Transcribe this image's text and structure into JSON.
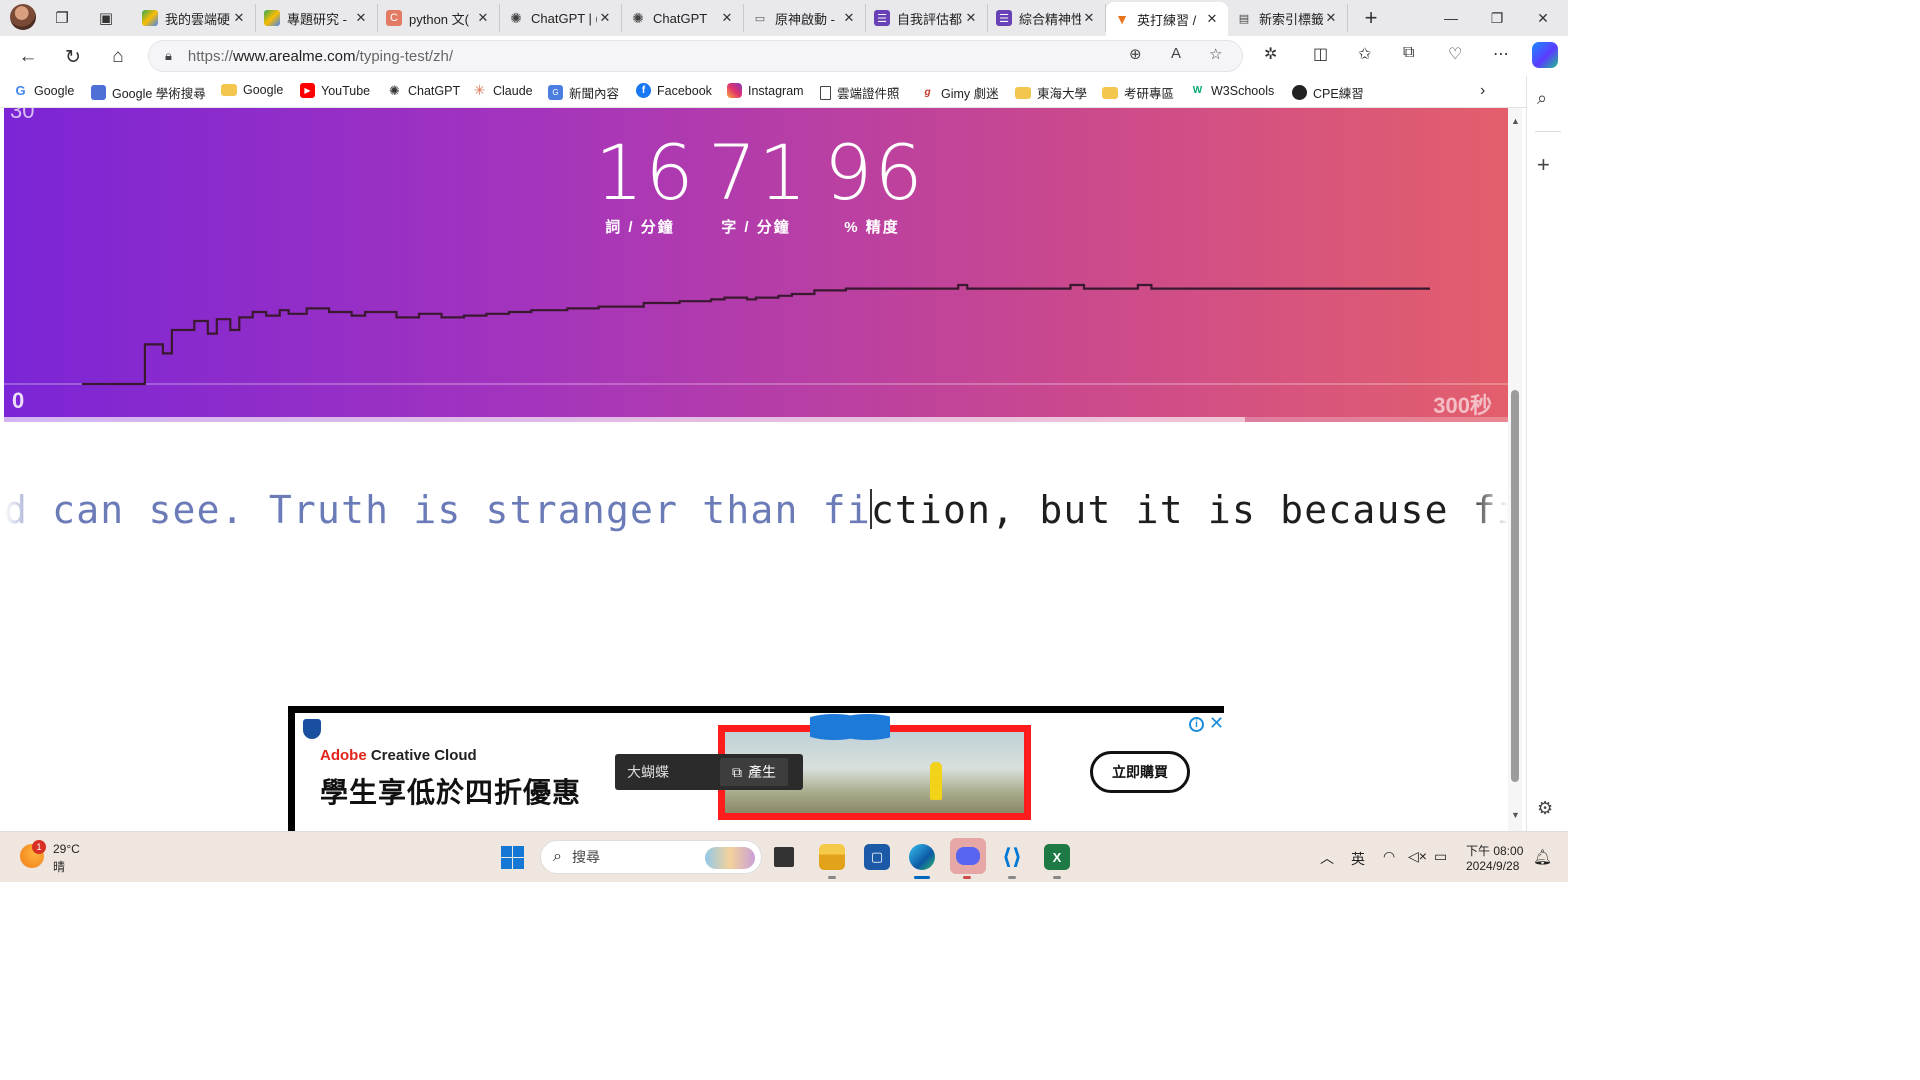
{
  "browser": {
    "tabs": [
      {
        "label": "我的雲端硬",
        "icon": "google-drive-icon",
        "active": false
      },
      {
        "label": "專題研究 -",
        "icon": "google-drive-icon",
        "active": false
      },
      {
        "label": "python 文(",
        "icon": "c-letter-icon",
        "active": false
      },
      {
        "label": "ChatGPT | (",
        "icon": "chatgpt-icon",
        "active": false
      },
      {
        "label": "ChatGPT",
        "icon": "chatgpt-icon",
        "active": false
      },
      {
        "label": "原神啟動 -",
        "icon": "chat-bubble-icon",
        "active": false
      },
      {
        "label": "自我評估都",
        "icon": "form-icon",
        "active": false
      },
      {
        "label": "綜合精神性",
        "icon": "form-icon",
        "active": false
      },
      {
        "label": "英打練習 /",
        "icon": "fox-icon",
        "active": true
      },
      {
        "label": "新索引標籤",
        "icon": "newtab-icon",
        "active": false
      }
    ],
    "url_prefix": "https://",
    "url_host": "www.arealme.com",
    "url_path": "/typing-test/zh/",
    "favorites": [
      {
        "label": "Google",
        "icon": "google-icon"
      },
      {
        "label": "Google 學術搜尋",
        "icon": "scholar-icon"
      },
      {
        "label": "Google",
        "icon": "folder-icon"
      },
      {
        "label": "YouTube",
        "icon": "youtube-icon"
      },
      {
        "label": "ChatGPT",
        "icon": "chatgpt-icon"
      },
      {
        "label": "Claude",
        "icon": "claude-icon"
      },
      {
        "label": "新聞內容",
        "icon": "news-icon"
      },
      {
        "label": "Facebook",
        "icon": "facebook-icon"
      },
      {
        "label": "Instagram",
        "icon": "instagram-icon"
      },
      {
        "label": "雲端證件照",
        "icon": "page-icon"
      },
      {
        "label": "Gimy 劇迷",
        "icon": "gimy-icon"
      },
      {
        "label": "東海大學",
        "icon": "folder-icon"
      },
      {
        "label": "考研專區",
        "icon": "folder-icon"
      },
      {
        "label": "W3Schools",
        "icon": "w3schools-icon"
      },
      {
        "label": "CPE練習",
        "icon": "github-icon"
      }
    ]
  },
  "typing_test": {
    "cut_label": "30",
    "stats": [
      {
        "value": "16",
        "label": "詞 / 分鐘"
      },
      {
        "value": "71",
        "label": "字 / 分鐘"
      },
      {
        "value": "96",
        "label": "% 精度"
      }
    ],
    "axis_start": "0",
    "axis_end": "300秒",
    "progress_fraction": 0.825,
    "typed_text": "d can see. Truth is stranger than fi",
    "untyped_text": "ction, but it is because fiction is"
  },
  "chart_data": {
    "type": "line",
    "xlim": [
      0,
      300
    ],
    "ylim": [
      0,
      30
    ],
    "x": [
      0,
      14,
      14,
      18,
      18,
      20,
      20,
      25,
      25,
      28,
      28,
      30,
      30,
      33,
      33,
      35,
      35,
      38,
      38,
      41,
      41,
      44,
      44,
      46,
      46,
      50,
      50,
      55,
      55,
      60,
      60,
      63,
      63,
      70,
      70,
      75,
      75,
      80,
      80,
      85,
      85,
      90,
      90,
      95,
      95,
      100,
      100,
      108,
      108,
      115,
      115,
      125,
      125,
      133,
      133,
      140,
      140,
      143,
      143,
      148,
      148,
      150,
      150,
      155,
      155,
      158,
      158,
      163,
      163,
      170,
      170,
      173,
      173,
      195,
      195,
      197,
      197,
      220,
      220,
      223,
      223,
      235,
      235,
      238,
      238,
      240,
      240,
      300
    ],
    "y": [
      0,
      0,
      11,
      11,
      8.5,
      8.5,
      15,
      15,
      17.5,
      17.5,
      14,
      14,
      18,
      18,
      15,
      15,
      18.5,
      18.5,
      20,
      20,
      19,
      19,
      20.5,
      20.5,
      19.5,
      19.5,
      21,
      21,
      20,
      20,
      19,
      19,
      20,
      20,
      18.5,
      18.5,
      19.5,
      19.5,
      18.5,
      18.5,
      19,
      19,
      19.5,
      19.5,
      20,
      20,
      20.5,
      20.5,
      21,
      21,
      21.5,
      21.5,
      22.5,
      22.5,
      23,
      23,
      23.5,
      23.5,
      24,
      24,
      23.5,
      23.5,
      24,
      24,
      24.5,
      24.5,
      25,
      25,
      26,
      26,
      26.5,
      26.5,
      26.5,
      26.5,
      27.5,
      27.5,
      26.5,
      26.5,
      27.5,
      27.5,
      26.5,
      26.5,
      27.5,
      27.5,
      26.5,
      26.5,
      26.5,
      26.5
    ]
  },
  "ad": {
    "brand_red": "Adobe",
    "brand_rest": " Creative Cloud",
    "headline": "學生享低於四折優惠",
    "chip_label": "大蝴蝶",
    "chip_button": "產生",
    "cta": "立即購買",
    "info": "i",
    "close": "✕"
  },
  "taskbar": {
    "weather_badge": "1",
    "temperature": "29°C",
    "condition": "晴",
    "search_placeholder": "搜尋",
    "ime": "英",
    "time": "下午 08:00",
    "date": "2024/9/28"
  },
  "colors": {
    "hero_start": "#7b25d6",
    "hero_end": "#e35f6c",
    "typed_text": "#6a7bb8"
  }
}
